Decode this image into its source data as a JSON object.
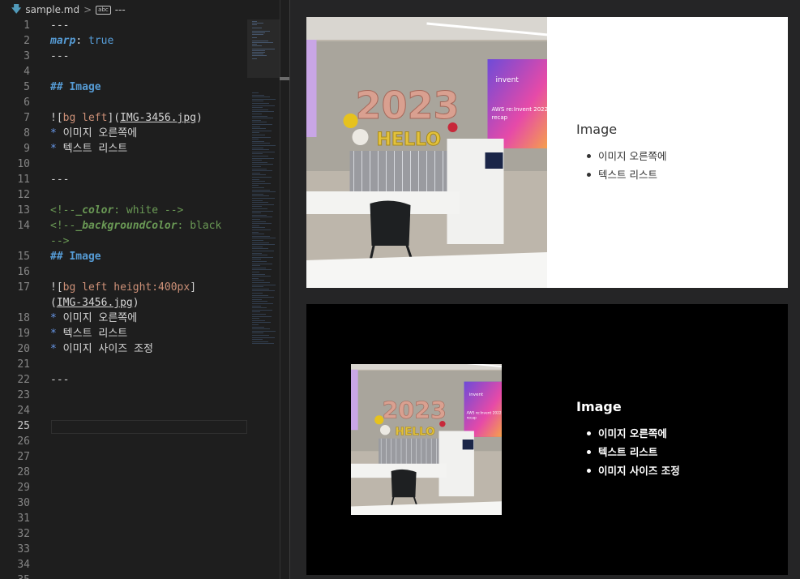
{
  "breadcrumb": {
    "file_name": "sample.md",
    "separator": ">",
    "symbol": "---"
  },
  "editor": {
    "lines": [
      {
        "n": "1",
        "segments": [
          {
            "t": "---",
            "c": "c-default"
          }
        ]
      },
      {
        "n": "2",
        "segments": [
          {
            "t": "marp",
            "c": "c-key"
          },
          {
            "t": ": ",
            "c": "c-default"
          },
          {
            "t": "true",
            "c": "c-bool"
          }
        ]
      },
      {
        "n": "3",
        "segments": [
          {
            "t": "---",
            "c": "c-default"
          }
        ]
      },
      {
        "n": "4",
        "segments": []
      },
      {
        "n": "5",
        "segments": [
          {
            "t": "## Image",
            "c": "c-head"
          }
        ]
      },
      {
        "n": "6",
        "segments": []
      },
      {
        "n": "7",
        "segments": [
          {
            "t": "![",
            "c": "c-bracket"
          },
          {
            "t": "bg left",
            "c": "c-alt"
          },
          {
            "t": "](",
            "c": "c-bracket"
          },
          {
            "t": "IMG-3456.jpg",
            "c": "c-link"
          },
          {
            "t": ")",
            "c": "c-bracket"
          }
        ]
      },
      {
        "n": "8",
        "segments": [
          {
            "t": "* ",
            "c": "c-bullet"
          },
          {
            "t": "이미지 오른쪽에",
            "c": "c-default"
          }
        ]
      },
      {
        "n": "9",
        "segments": [
          {
            "t": "* ",
            "c": "c-bullet"
          },
          {
            "t": "텍스트 리스트",
            "c": "c-default"
          }
        ]
      },
      {
        "n": "10",
        "segments": []
      },
      {
        "n": "11",
        "segments": [
          {
            "t": "---",
            "c": "c-default"
          }
        ]
      },
      {
        "n": "12",
        "segments": []
      },
      {
        "n": "13",
        "segments": [
          {
            "t": "<!--",
            "c": "c-comment"
          },
          {
            "t": "_color",
            "c": "c-ckey"
          },
          {
            "t": ": white -->",
            "c": "c-comment"
          }
        ]
      },
      {
        "n": "14",
        "segments": [
          {
            "t": "<!--",
            "c": "c-comment"
          },
          {
            "t": "_backgroundColor",
            "c": "c-ckey"
          },
          {
            "t": ": black",
            "c": "c-comment"
          }
        ]
      },
      {
        "n": "",
        "segments": [
          {
            "t": "-->",
            "c": "c-comment"
          }
        ]
      },
      {
        "n": "15",
        "segments": [
          {
            "t": "## Image",
            "c": "c-head"
          }
        ]
      },
      {
        "n": "16",
        "segments": []
      },
      {
        "n": "17",
        "segments": [
          {
            "t": "![",
            "c": "c-bracket"
          },
          {
            "t": "bg left height:400px",
            "c": "c-alt"
          },
          {
            "t": "]",
            "c": "c-bracket"
          }
        ]
      },
      {
        "n": "",
        "segments": [
          {
            "t": "(",
            "c": "c-bracket"
          },
          {
            "t": "IMG-3456.jpg",
            "c": "c-link"
          },
          {
            "t": ")",
            "c": "c-bracket"
          }
        ]
      },
      {
        "n": "18",
        "segments": [
          {
            "t": "* ",
            "c": "c-bullet"
          },
          {
            "t": "이미지 오른쪽에",
            "c": "c-default"
          }
        ]
      },
      {
        "n": "19",
        "segments": [
          {
            "t": "* ",
            "c": "c-bullet"
          },
          {
            "t": "텍스트 리스트",
            "c": "c-default"
          }
        ]
      },
      {
        "n": "20",
        "segments": [
          {
            "t": "* ",
            "c": "c-bullet"
          },
          {
            "t": "이미지 사이즈 조정",
            "c": "c-default"
          }
        ]
      },
      {
        "n": "21",
        "segments": []
      },
      {
        "n": "22",
        "segments": [
          {
            "t": "---",
            "c": "c-default"
          }
        ]
      },
      {
        "n": "23",
        "segments": []
      },
      {
        "n": "24",
        "segments": []
      },
      {
        "n": "25",
        "segments": [],
        "active": true
      },
      {
        "n": "26",
        "segments": []
      },
      {
        "n": "27",
        "segments": []
      },
      {
        "n": "28",
        "segments": []
      },
      {
        "n": "29",
        "segments": []
      },
      {
        "n": "30",
        "segments": []
      },
      {
        "n": "31",
        "segments": []
      },
      {
        "n": "32",
        "segments": []
      },
      {
        "n": "33",
        "segments": []
      },
      {
        "n": "34",
        "segments": []
      },
      {
        "n": "35",
        "segments": []
      }
    ]
  },
  "slides": [
    {
      "title": "Image",
      "items": [
        "이미지 오른쪽에",
        "텍스트 리스트"
      ]
    },
    {
      "title": "Image",
      "items": [
        "이미지 오른쪽에",
        "텍스트 리스트",
        "이미지 사이즈 조정"
      ]
    }
  ],
  "photo": {
    "balloon_year": "2023",
    "balloon_word": "HELLO",
    "screen_line1": "AWS re:Invent 2022",
    "screen_line2": "recap",
    "screen_brand": "invent"
  },
  "colors": {
    "editor_bg": "#1e1e1e",
    "preview_bg": "#252526",
    "slide1_bg": "#ffffff",
    "slide2_bg": "#000000",
    "keyword_blue": "#569cd6",
    "string_orange": "#ce9178",
    "comment_green": "#6a9955"
  }
}
